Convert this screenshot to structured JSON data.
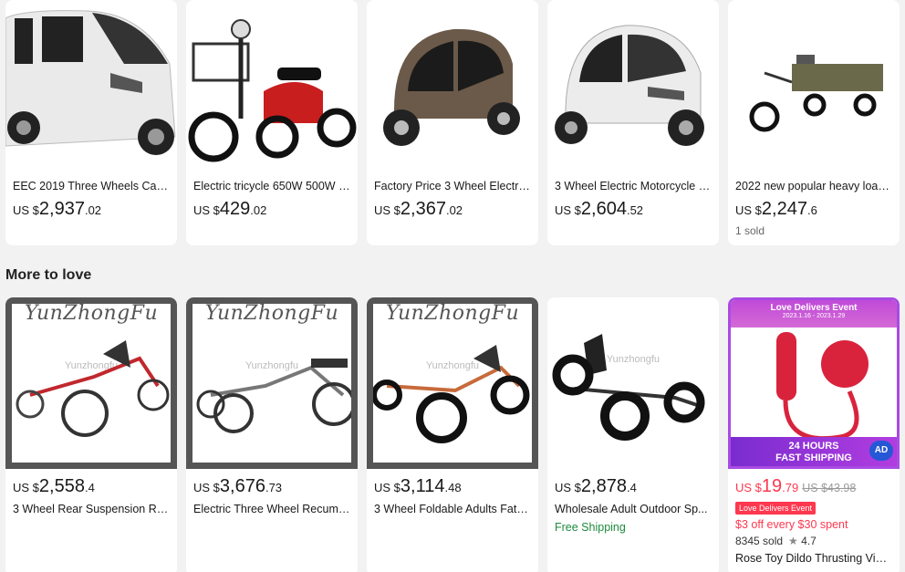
{
  "top_row": [
    {
      "title": "EEC 2019 Three Wheels Carg...",
      "currency": "US $",
      "price_int": "2,937",
      "price_cents": ".02",
      "sold": ""
    },
    {
      "title": "Electric tricycle 650W 500W 3...",
      "currency": "US $",
      "price_int": "429",
      "price_cents": ".02",
      "sold": ""
    },
    {
      "title": "Factory Price 3 Wheel Electric...",
      "currency": "US $",
      "price_int": "2,367",
      "price_cents": ".02",
      "sold": ""
    },
    {
      "title": "3 Wheel Electric Motorcycle C...",
      "currency": "US $",
      "price_int": "2,604",
      "price_cents": ".52",
      "sold": ""
    },
    {
      "title": "2022 new popular heavy load...",
      "currency": "US $",
      "price_int": "2,247",
      "price_cents": ".6",
      "sold": "1 sold"
    }
  ],
  "section": {
    "title": "More to love"
  },
  "bottom_row": [
    {
      "title": "3 Wheel Rear Suspension Rec...",
      "currency": "US $",
      "price_int": "2,558",
      "price_cents": ".4",
      "brand": "YunZhongFu",
      "watermark": "Yunzhongfu"
    },
    {
      "title": "Electric Three Wheel Recumb...",
      "currency": "US $",
      "price_int": "3,676",
      "price_cents": ".73",
      "brand": "YunZhongFu",
      "watermark": "Yunzhongfu"
    },
    {
      "title": "3 Wheel Foldable Adults Fat T...",
      "currency": "US $",
      "price_int": "3,114",
      "price_cents": ".48",
      "brand": "YunZhongFu",
      "watermark": "Yunzhongfu"
    },
    {
      "title": "Wholesale Adult Outdoor Sp...",
      "currency": "US $",
      "price_int": "2,878",
      "price_cents": ".4",
      "shipping": "Free Shipping",
      "watermark": "Yunzhongfu"
    }
  ],
  "promo": {
    "head": "Love Delivers Event",
    "dates": "2023.1.16 - 2023.1.29",
    "foot_line1": "24 HOURS",
    "foot_line2": "FAST SHIPPING",
    "ad_label": "AD",
    "currency": "US $",
    "price_int": "19",
    "price_cents": ".79",
    "old_price": "US $43.98",
    "badge": "Love Delivers Event",
    "offer": "$3 off every $30 spent",
    "sold": "8345 sold",
    "rating": "4.7",
    "title": "Rose Toy Dildo Thrusting Vibr...",
    "accent": "#fd384f"
  }
}
